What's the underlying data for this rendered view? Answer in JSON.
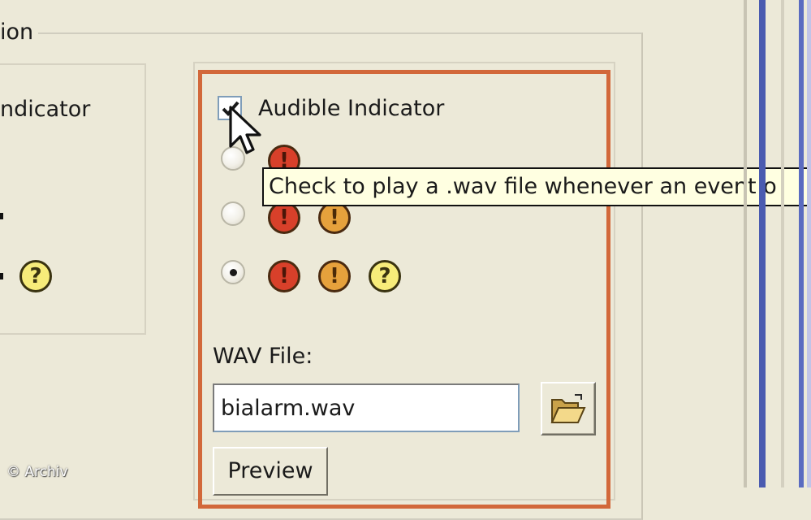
{
  "group": {
    "title": "ion"
  },
  "left_panel": {
    "label": "ndicator"
  },
  "audible": {
    "checkbox_label": "Audible Indicator",
    "checked": true,
    "radio_options": [
      {
        "selected": false,
        "icons": [
          "error-icon"
        ]
      },
      {
        "selected": false,
        "icons": [
          "error-icon",
          "warning-icon"
        ]
      },
      {
        "selected": true,
        "icons": [
          "error-icon",
          "warning-icon",
          "info-icon"
        ]
      }
    ]
  },
  "tooltip": {
    "text": "Check to play a .wav file whenever an event o"
  },
  "icons": {
    "error_glyph": "!",
    "warning_glyph": "!",
    "info_glyph": "?",
    "error_color": "#d8402a",
    "warning_color": "#e6a13c",
    "info_color": "#f7ec7a"
  },
  "wav": {
    "label": "WAV File:",
    "value": "bialarm.wav",
    "preview_label": "Preview"
  },
  "highlight_color": "#d2683a",
  "watermark": "© Archiv"
}
